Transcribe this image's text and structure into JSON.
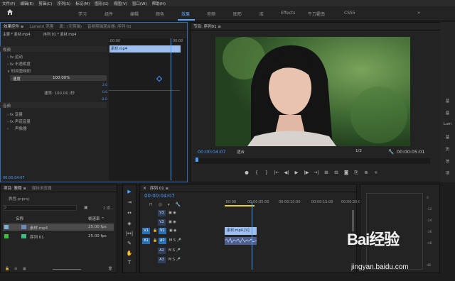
{
  "menu": [
    "文件(F)",
    "编辑(E)",
    "剪辑(C)",
    "序列(S)",
    "标记(M)",
    "图形(G)",
    "视图(V)",
    "窗口(W)",
    "帮助(H)"
  ],
  "workspaces": [
    {
      "label": "学习"
    },
    {
      "label": "组件"
    },
    {
      "label": "编辑"
    },
    {
      "label": "颜色"
    },
    {
      "label": "效果"
    },
    {
      "label": "音频"
    },
    {
      "label": "图形"
    },
    {
      "label": "库"
    },
    {
      "label": "Effects"
    },
    {
      "label": "牛刀霍南"
    },
    {
      "label": "CSS5"
    }
  ],
  "active_workspace": "效果",
  "effects": {
    "tabs": [
      "效果控件 ≡",
      "Lumetri 范围",
      "源：(无剪辑)",
      "音频剪辑混合器: 序列 01"
    ],
    "source": "主要 * 素材.mp4",
    "source_right": "序列 01 * 素材.mp4",
    "section_video": "视频",
    "motion": "运动",
    "opacity": "不透明度",
    "time_remap": "时间重映射",
    "speed_label": "速度",
    "speed_value": "100.00%",
    "rate_label": "速率: 100.00 /秒",
    "section_audio": "音频",
    "volume": "音量",
    "channel_volume": "声道音量",
    "panner": "声像器",
    "tl_time": ":00:00",
    "tl_time2": "00:00",
    "clip": "素材.mp4",
    "scale_hi": "2.0",
    "scale_lo": "0.0",
    "scale_neg": "-2.0",
    "timecode": "00:00:04:07"
  },
  "program": {
    "title": "节目: 序列01 ≡",
    "timecode": "00:00:04:07",
    "fit": "适合",
    "resolution": "1/2",
    "duration": "00:00:05:01",
    "controls": [
      "●",
      "{",
      "}",
      "|←",
      "◀|",
      "▶",
      "|▶",
      "→|",
      "⊞",
      "⊟",
      "◙",
      "⎘",
      "⊕",
      "+"
    ]
  },
  "right_strip": [
    "基",
    "基",
    "Lum",
    "基",
    "历",
    "信",
    "项"
  ],
  "project": {
    "tabs": [
      "项目: 教程 ≡",
      "媒体浏览器"
    ],
    "file": "教程.prproj",
    "count": "1 项...",
    "col_name": "名称",
    "col_fps": "帧速率 ^",
    "items": [
      {
        "name": "素材.mp4",
        "fps": "25.00 fps"
      },
      {
        "name": "序列 01",
        "fps": "25.00 fps"
      }
    ]
  },
  "tools": [
    "▶",
    "⇥",
    "↔",
    "◈",
    "|↔|",
    "✎",
    "✋",
    "T"
  ],
  "timeline": {
    "title": "序列 01 ≡",
    "timecode": "00:00:04:07",
    "ruler": [
      ":00:00",
      "00:00:05:00",
      "00:00:10:00",
      "00:00:15:00",
      "00:00:20:00"
    ],
    "tracks": [
      {
        "src": "",
        "tag": "V3"
      },
      {
        "src": "",
        "tag": "V2"
      },
      {
        "src": "V1",
        "tag": "V1"
      },
      {
        "src": "A1",
        "tag": "A1"
      },
      {
        "src": "",
        "tag": "A2"
      },
      {
        "src": "",
        "tag": "A3"
      }
    ],
    "track_flags": "M S",
    "clip_v1": "素材.mp4 [V]"
  },
  "meter": {
    "scale": [
      "0",
      "-12",
      "-24",
      "-36",
      "-48",
      "dB"
    ]
  },
  "watermark": {
    "brand": "Bai经验",
    "url": "jingyan.baidu.com"
  }
}
